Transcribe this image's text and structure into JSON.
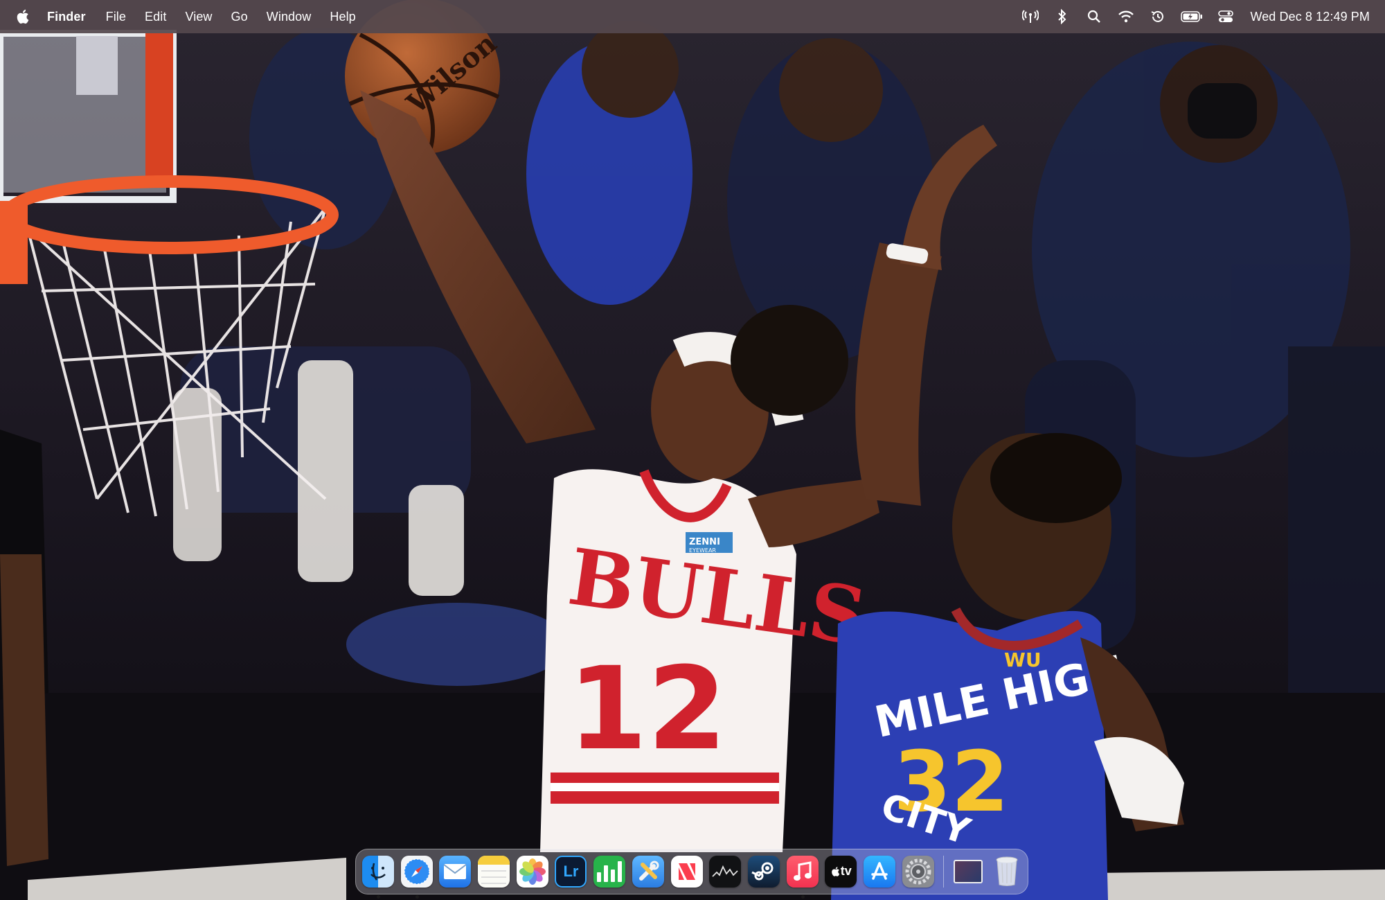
{
  "menubar": {
    "app_name": "Finder",
    "menus": [
      "File",
      "Edit",
      "View",
      "Go",
      "Window",
      "Help"
    ],
    "status_icons": [
      "airdrop-icon",
      "bluetooth-icon",
      "spotlight-search-icon",
      "wifi-icon",
      "time-machine-icon",
      "battery-charging-icon",
      "control-center-icon"
    ],
    "clock": "Wed Dec 8  12:49 PM"
  },
  "wallpaper": {
    "jersey_left": {
      "team_text": "BULLS",
      "number": "12",
      "patch_text": "ZENNI",
      "patch_sub": "EYEWEAR"
    },
    "jersey_right": {
      "team_text": "MILE HIGH",
      "city_text": "CITY",
      "number": "32",
      "patch_text": "WU"
    },
    "ball_text": "Wilson"
  },
  "dock": {
    "apps": [
      {
        "name": "Finder",
        "icon": "finder-icon",
        "running": true
      },
      {
        "name": "Safari",
        "icon": "safari-icon",
        "running": true
      },
      {
        "name": "Mail",
        "icon": "mail-icon",
        "running": false
      },
      {
        "name": "Notes",
        "icon": "notes-icon",
        "running": false
      },
      {
        "name": "Photos",
        "icon": "photos-icon",
        "running": false
      },
      {
        "name": "Lightroom",
        "icon": "lightroom-icon",
        "label": "Lr",
        "running": false
      },
      {
        "name": "Numbers",
        "icon": "numbers-icon",
        "running": false
      },
      {
        "name": "Xcode Tools",
        "icon": "tools-icon",
        "running": false
      },
      {
        "name": "News",
        "icon": "news-icon",
        "running": false
      },
      {
        "name": "Stocks",
        "icon": "stocks-icon",
        "running": false
      },
      {
        "name": "Steam",
        "icon": "steam-icon",
        "running": false
      },
      {
        "name": "Music",
        "icon": "music-icon",
        "running": true
      },
      {
        "name": "Apple TV",
        "icon": "apple-tv-icon",
        "label": "tv",
        "running": false
      },
      {
        "name": "App Store",
        "icon": "app-store-icon",
        "running": false
      },
      {
        "name": "System Preferences",
        "icon": "system-preferences-icon",
        "running": false
      }
    ],
    "documents": [
      {
        "name": "Downloads stack",
        "icon": "downloads-stack-icon"
      },
      {
        "name": "Trash",
        "icon": "trash-icon"
      }
    ]
  },
  "colors": {
    "menubar": "#54484e",
    "bulls_red": "#d0222d",
    "nuggets_blue": "#2c3fb4",
    "rim_orange": "#ef5b2c"
  }
}
